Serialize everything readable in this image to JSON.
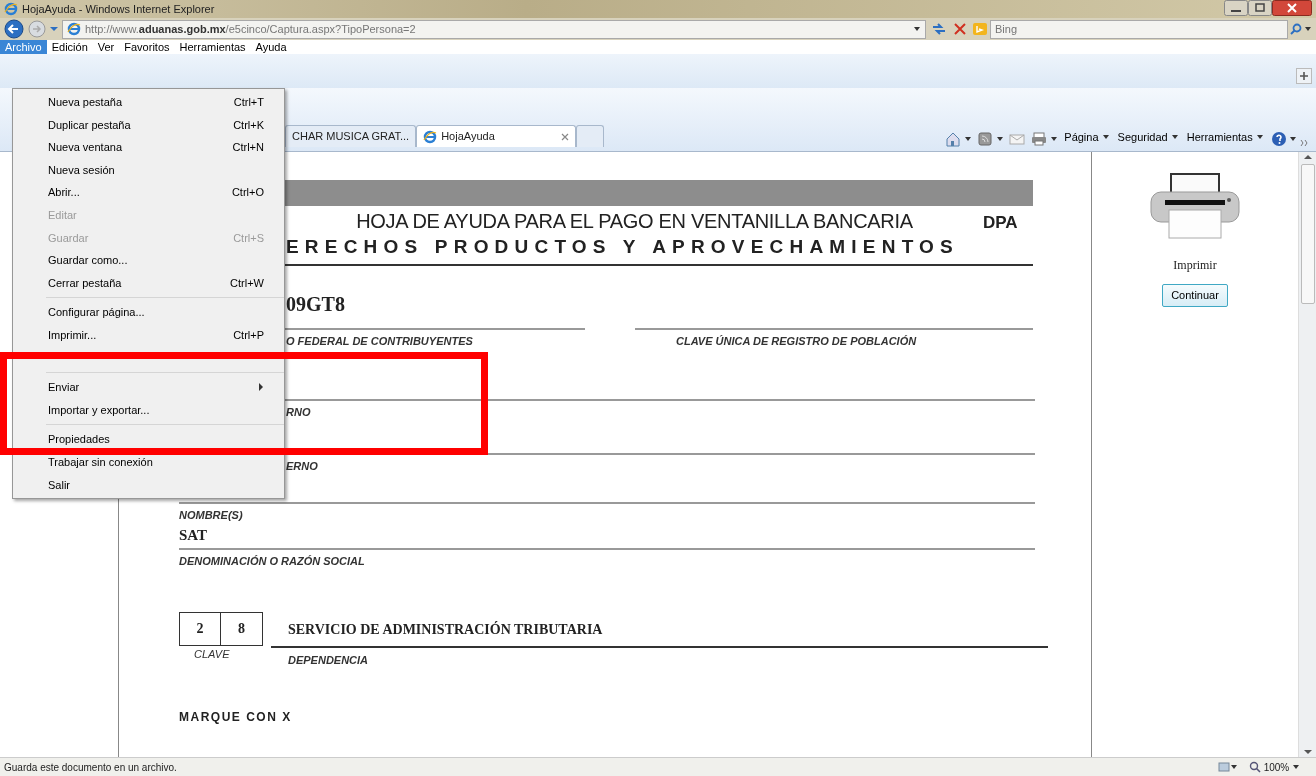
{
  "window": {
    "title": "HojaAyuda - Windows Internet Explorer"
  },
  "address_bar": {
    "url": "http://www.**aduanas.gob.mx**/e5cinco/Captura.aspx?TipoPersona=2"
  },
  "search": {
    "placeholder": "Bing"
  },
  "menubar": [
    {
      "label": "Archivo",
      "selected": true
    },
    {
      "label": "Edición",
      "selected": false
    },
    {
      "label": "Ver",
      "selected": false
    },
    {
      "label": "Favoritos",
      "selected": false
    },
    {
      "label": "Herramientas",
      "selected": false
    },
    {
      "label": "Ayuda",
      "selected": false
    }
  ],
  "file_menu": [
    {
      "kind": "item",
      "label": "Nueva pestaña",
      "shortcut": "Ctrl+T",
      "disabled": false
    },
    {
      "kind": "item",
      "label": "Duplicar pestaña",
      "shortcut": "Ctrl+K",
      "disabled": false
    },
    {
      "kind": "item",
      "label": "Nueva ventana",
      "shortcut": "Ctrl+N",
      "disabled": false
    },
    {
      "kind": "item",
      "label": "Nueva sesión",
      "disabled": false
    },
    {
      "kind": "item",
      "label": "Abrir...",
      "shortcut": "Ctrl+O",
      "disabled": false
    },
    {
      "kind": "item",
      "label": "Editar",
      "disabled": true
    },
    {
      "kind": "item",
      "label": "Guardar",
      "shortcut": "Ctrl+S",
      "disabled": true
    },
    {
      "kind": "item",
      "label": "Guardar como...",
      "disabled": false
    },
    {
      "kind": "item",
      "label": "Cerrar pestaña",
      "shortcut": "Ctrl+W",
      "disabled": false
    },
    {
      "kind": "separator"
    },
    {
      "kind": "item",
      "label": "Configurar página...",
      "disabled": false
    },
    {
      "kind": "item",
      "label": "Imprimir...",
      "shortcut": "Ctrl+P",
      "disabled": false
    },
    {
      "kind": "covered"
    },
    {
      "kind": "separator"
    },
    {
      "kind": "submenu",
      "label": "Enviar",
      "disabled": false
    },
    {
      "kind": "item",
      "label": "Importar y exportar...",
      "disabled": false
    },
    {
      "kind": "separator"
    },
    {
      "kind": "item",
      "label": "Propiedades",
      "disabled": false
    },
    {
      "kind": "item",
      "label": "Trabajar sin conexión",
      "disabled": false
    },
    {
      "kind": "item",
      "label": "Salir",
      "disabled": false
    }
  ],
  "tabs": [
    {
      "label": "CHAR MUSICA GRAT...",
      "selected": false
    },
    {
      "label": "HojaAyuda",
      "selected": true
    }
  ],
  "command_bar": [
    {
      "kind": "home"
    },
    {
      "kind": "feeds"
    },
    {
      "kind": "mail"
    },
    {
      "kind": "print"
    },
    {
      "kind": "menu",
      "label": "Página"
    },
    {
      "kind": "menu",
      "label": "Seguridad"
    },
    {
      "kind": "menu",
      "label": "Herramientas"
    },
    {
      "kind": "help"
    }
  ],
  "document": {
    "title": "HOJA DE AYUDA PARA EL PAGO EN VENTANILLA BANCARIA",
    "code": "DPA",
    "subtitle": "ERECHOS PRODUCTOS Y APROVECHAMIENTOS",
    "rfc_value": "09GT8",
    "rfc_label": "O FEDERAL DE CONTRIBUYENTES",
    "curp_label": "CLAVE ÚNICA DE REGISTRO DE POBLACIÓN",
    "paterno_label": "RNO",
    "materno_label": "ERNO",
    "nombre_label": "NOMBRE(S)",
    "razon_value": "SAT",
    "razon_label": "DENOMINACIÓN O RAZÓN SOCIAL",
    "clave_digits": [
      "2",
      "8"
    ],
    "dependencia_value": "SERVICIO DE ADMINISTRACIÓN TRIBUTARIA",
    "clave_label": "CLAVE",
    "dependencia_label": "DEPENDENCIA",
    "mark_label": "MARQUE CON X"
  },
  "side": {
    "print_label": "Imprimir",
    "continue_button": "Continuar"
  },
  "status_bar": {
    "text": "Guarda este documento en un archivo.",
    "zoom": "100%"
  }
}
